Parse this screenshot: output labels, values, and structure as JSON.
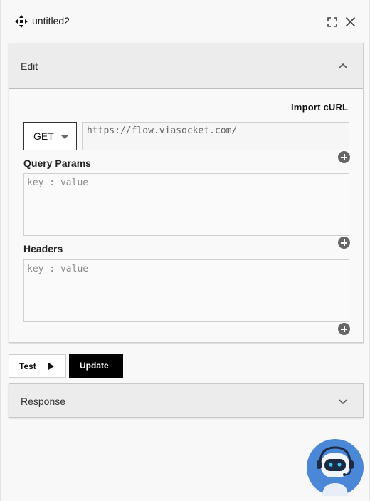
{
  "header": {
    "title_value": "untitled2",
    "move_icon": "move-arrows-icon",
    "expand_icon": "expand-icon",
    "close_icon": "close-icon"
  },
  "edit": {
    "title": "Edit",
    "import_label": "Import cURL",
    "method": "GET",
    "url_placeholder": "https://flow.viasocket.com/",
    "query_params_label": "Query Params",
    "query_params_placeholder": "key : value",
    "headers_label": "Headers",
    "headers_placeholder": "key : value"
  },
  "actions": {
    "test_label": "Test",
    "update_label": "Update"
  },
  "response": {
    "title": "Response"
  },
  "assistant": {
    "icon": "robot-assistant-icon"
  },
  "colors": {
    "bot_bg": "#4a87d6",
    "primary_button": "#000000",
    "panel_header": "#ececec"
  }
}
